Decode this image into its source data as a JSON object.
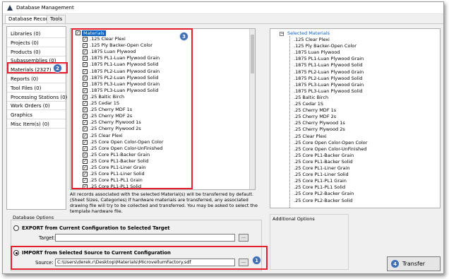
{
  "window": {
    "title": "Database Management"
  },
  "menu_tabs": [
    "Database Records",
    "Tools"
  ],
  "sidebar": {
    "items": [
      "Libraries (0)",
      "Projects (0)",
      "Products (0)",
      "Subassemblies (0)",
      "Materials (2327)",
      "Reports (0)",
      "Tool Files (0)",
      "Processing Stations (0)",
      "Work Orders (0)",
      "Graphics",
      "Misc Item(s) (0)"
    ],
    "selected_index": 4
  },
  "tree": {
    "root_label": "Materials",
    "root_checked": true,
    "items": [
      ".125 Clear Plexi",
      ".125 Ply Backer-Open Color",
      ".1875 Luan Plywood",
      ".1875 PL1-Luan Plywood Grain",
      ".1875 PL1-Luan Plywood Solid",
      ".1875 PL2-Luan Plywood Grain",
      ".1875 PL2-Luan Plywood Solid",
      ".1875 PL3-Luan Plywood Grain",
      ".1875 PL3-Luan Plywood Solid",
      ".25 Baltic Birch",
      ".25 Cedar 1S",
      ".25 Cherry MDF 1s",
      ".25 Cherry MDF 2s",
      ".25 Cherry Plywood 1s",
      ".25 Cherry Plywood 2s",
      ".25 Clear Plexi",
      ".25 Core Open Color-Open Color",
      ".25 Core Open Color-UnFinished",
      ".25 Core PL1-Backer Grain",
      ".25 Core PL1-Backer Solid",
      ".25 Core PL1-Liner Grain",
      ".25 Core PL1-Liner Solid",
      ".25 Core PL1-PL1 Grain",
      ".25 Core PL1-PL1 Solid"
    ]
  },
  "info_text": "All records associated with the selected Material(s) will be transferred by default.  (Sheet Sizes, Categories) If hardware materials are transferred, any associated drawing file will try to be collected and transferred.  You may be asked to select the template hardware file.",
  "selected_materials": {
    "root_label": "Selected Materials",
    "items": [
      ".125 Clear Plexi",
      ".125 Ply Backer-Open Color",
      ".1875 Luan Plywood",
      ".1875 PL1-Luan Plywood Grain",
      ".1875 PL1-Luan Plywood Solid",
      ".1875 PL2-Luan Plywood Grain",
      ".1875 PL2-Luan Plywood Solid",
      ".1875 PL3-Luan Plywood Grain",
      ".1875 PL3-Luan Plywood Solid",
      ".25 Baltic Birch",
      ".25 Cedar 1S",
      ".25 Cherry MDF 1s",
      ".25 Cherry MDF 2s",
      ".25 Cherry Plywood 1s",
      ".25 Cherry Plywood 2s",
      ".25 Clear Plexi",
      ".25 Core Open Color-Open Color",
      ".25 Core Open Color-UnFinished",
      ".25 Core PL1-Backer Grain",
      ".25 Core PL1-Backer Solid",
      ".25 Core PL1-Liner Grain",
      ".25 Core PL1-Liner Solid",
      ".25 Core PL1-PL1 Grain",
      ".25 Core PL1-PL1 Solid",
      ".25 Core PL2-Backer Grain",
      ".25 Core PL2-Backer Solid"
    ]
  },
  "database_options": {
    "label": "Database Options",
    "export_label": "EXPORT from Current Configuration to Selected Target",
    "target_label": "Target:",
    "target_value": "",
    "import_label": "IMPORT from Selected Source to Current Configuration",
    "source_label": "Source:",
    "source_value": "C:\\Users\\derek.r\\Desktop\\Materials\\MicrovellumFactory.sdf",
    "browse_label": "...",
    "selected": "import"
  },
  "additional_options": {
    "label": "Additional Options"
  },
  "transfer_button": {
    "label": "Transfer"
  },
  "callouts": [
    "1",
    "2",
    "3",
    "4"
  ],
  "colors": {
    "callout_red": "#e5202e",
    "badge_blue": "#3f6fb5",
    "selection_blue": "#0a5fbf"
  }
}
